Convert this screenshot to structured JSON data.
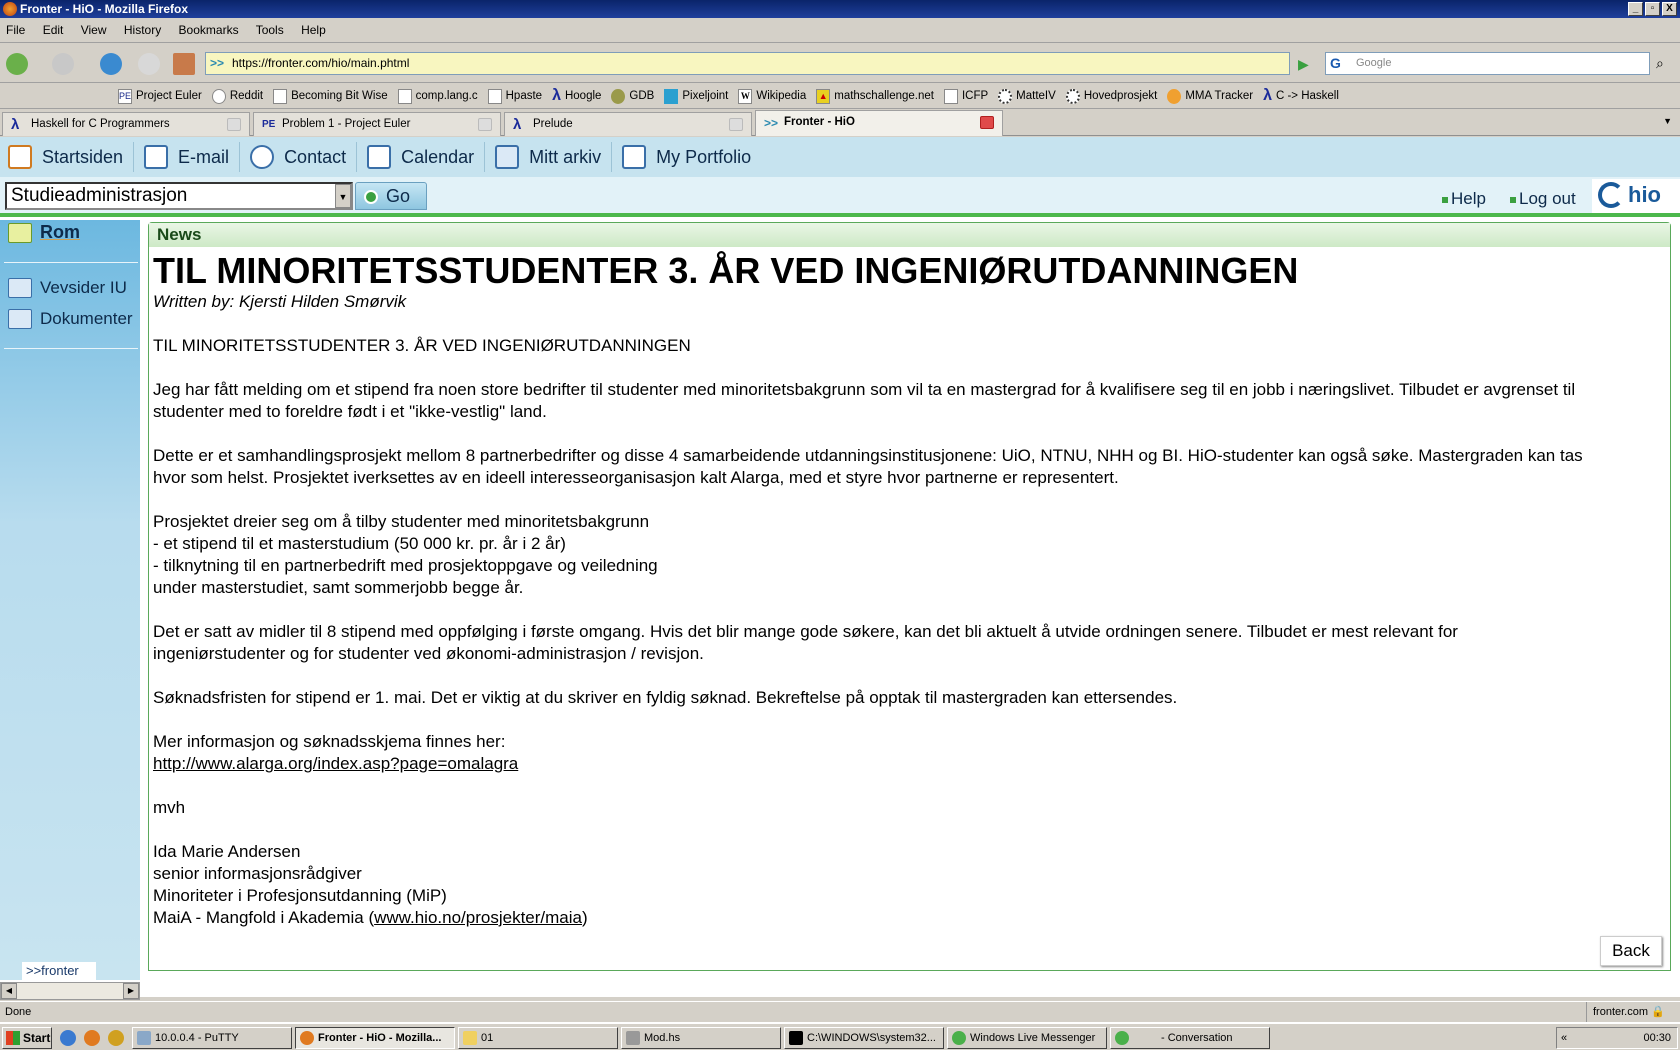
{
  "window": {
    "title": "Fronter - HiO - Mozilla Firefox"
  },
  "menu": [
    "File",
    "Edit",
    "View",
    "History",
    "Bookmarks",
    "Tools",
    "Help"
  ],
  "nav": {
    "url": "https://fronter.com/hio/main.phtml",
    "search_placeholder": "Google"
  },
  "bookmarks": [
    "Project Euler",
    "Reddit",
    "Becoming Bit Wise",
    "comp.lang.c",
    "Hpaste",
    "Hoogle",
    "GDB",
    "Pixeljoint",
    "Wikipedia",
    "mathschallenge.net",
    "ICFP",
    "MatteIV",
    "Hovedprosjekt",
    "MMA Tracker",
    "C -> Haskell"
  ],
  "tabs": [
    {
      "label": "Haskell for C Programmers",
      "icon": "lambda-icon"
    },
    {
      "label": "Problem 1 - Project Euler",
      "icon": "pe-icon"
    },
    {
      "label": "Prelude",
      "icon": "lambda-icon"
    },
    {
      "label": "Fronter - HiO",
      "icon": "fronter-icon",
      "active": true
    }
  ],
  "fronter_nav": [
    "Startsiden",
    "E-mail",
    "Contact",
    "Calendar",
    "Mitt arkiv",
    "My Portfolio"
  ],
  "room_select": {
    "value": "Studieadministrasjon",
    "go_label": "Go"
  },
  "links": {
    "help": "Help",
    "logout": "Log out",
    "logo": "hio"
  },
  "sidebar": {
    "room": "Rom",
    "items": [
      "Vevsider IU",
      "Dokumenter"
    ],
    "logo": ">>fronter"
  },
  "news": {
    "section": "News",
    "title": "TIL MINORITETSSTUDENTER 3. ÅR VED INGENIØRUTDANNINGEN",
    "author": "Written by: Kjersti Hilden Smørvik",
    "lines": [
      "TIL MINORITETSSTUDENTER 3. ÅR VED INGENIØRUTDANNINGEN",
      "",
      "Jeg har fått melding om et stipend fra noen store bedrifter til studenter med minoritetsbakgrunn som vil ta en mastergrad for å kvalifisere seg til en jobb i næringslivet. Tilbudet er avgrenset til",
      "studenter med to foreldre født i et \"ikke-vestlig\" land.",
      "",
      "Dette er et samhandlingsprosjekt mellom 8 partnerbedrifter og disse 4 samarbeidende utdanningsinstitusjonene: UiO, NTNU, NHH og BI. HiO-studenter kan også søke. Mastergraden kan tas",
      "hvor som helst. Prosjektet iverksettes av en ideell interesseorganisasjon kalt Alarga, med et styre hvor partnerne er representert.",
      "",
      "Prosjektet dreier seg om å tilby studenter med minoritetsbakgrunn",
      "- et stipend til et masterstudium (50 000 kr. pr. år i 2 år)",
      "- tilknytning til en partnerbedrift med prosjektoppgave og veiledning",
      "under masterstudiet, samt sommerjobb begge år.",
      "",
      "Det er satt av midler til 8 stipend med oppfølging i første omgang. Hvis det blir mange gode søkere, kan det bli aktuelt å utvide ordningen senere. Tilbudet er mest relevant for",
      "ingeniørstudenter og for studenter ved økonomi-administrasjon / revisjon.",
      "",
      "Søknadsfristen for stipend er 1. mai. Det er viktig at du skriver en fyldig søknad. Bekreftelse på opptak til mastergraden kan ettersendes.",
      "",
      "Mer informasjon og søknadsskjema finnes her:"
    ],
    "link": "http://www.alarga.org/index.asp?page=omalagra",
    "sign_lines": [
      "",
      "mvh",
      "",
      "Ida Marie Andersen",
      "senior informasjonsrådgiver",
      "Minoriteter i Profesjonsutdanning (MiP)"
    ],
    "last_prefix": "MaiA - Mangfold i Akademia (",
    "last_link": "www.hio.no/prosjekter/maia",
    "last_suffix": ")",
    "back": "Back"
  },
  "status": {
    "text": "Done",
    "domain": "fronter.com"
  },
  "taskbar": {
    "start": "Start",
    "tasks": [
      "10.0.0.4 - PuTTY",
      "Fronter - HiO - Mozilla...",
      "01",
      "Mod.hs",
      "C:\\WINDOWS\\system32...",
      "Windows Live Messenger",
      "- Conversation"
    ],
    "clock": "00:30"
  }
}
